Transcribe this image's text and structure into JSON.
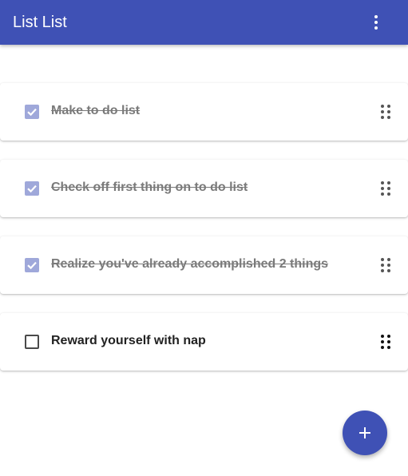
{
  "app_bar": {
    "title": "List List",
    "menu_icon": "more-vert-icon",
    "color": "#3f51b5"
  },
  "items": [
    {
      "text": "Make to do list",
      "checked": true
    },
    {
      "text": "Check off first thing on to do list",
      "checked": true
    },
    {
      "text": "Realize you've already accomplished 2 things",
      "checked": true
    },
    {
      "text": "Reward yourself with nap",
      "checked": false
    }
  ],
  "fab": {
    "icon": "plus-icon",
    "color": "#3f51b5"
  },
  "colors": {
    "checked_box": "#9fa8da",
    "done_text": "#7a7a7a",
    "todo_text": "#222222"
  }
}
